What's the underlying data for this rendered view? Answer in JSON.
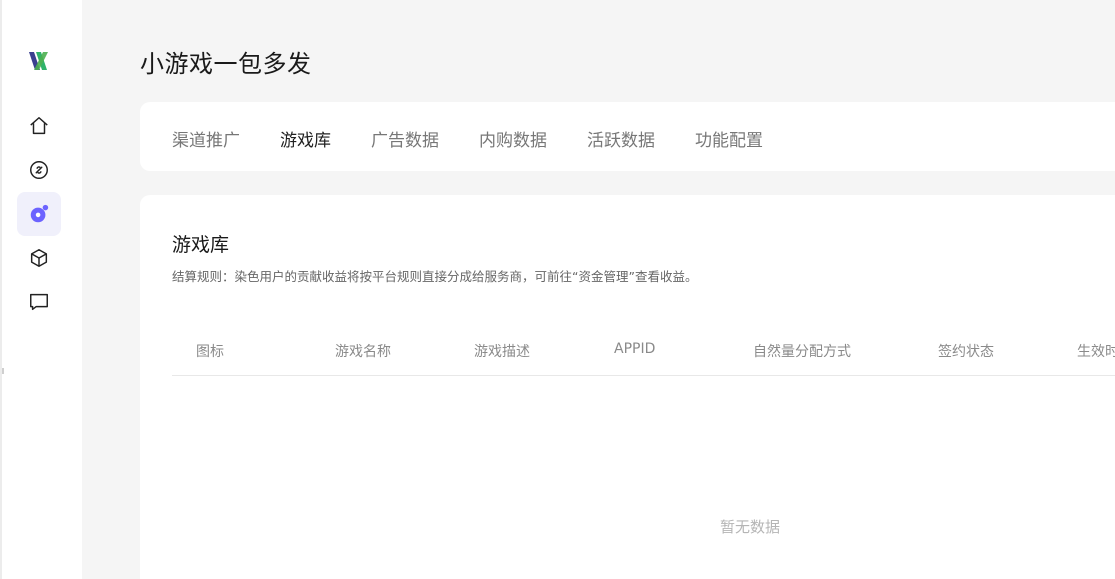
{
  "app": {
    "logo_icon": "brand-logo-icon",
    "accent": "#6c63ff"
  },
  "sidebar": {
    "items": [
      {
        "icon": "home-icon",
        "active": false
      },
      {
        "icon": "link-icon",
        "active": false
      },
      {
        "icon": "game-icon",
        "active": true
      },
      {
        "icon": "package-cube-icon",
        "active": false
      },
      {
        "icon": "message-icon",
        "active": false
      }
    ]
  },
  "header": {
    "title": "小游戏一包多发"
  },
  "tabs": [
    {
      "label": "渠道推广",
      "active": false
    },
    {
      "label": "游戏库",
      "active": true
    },
    {
      "label": "广告数据",
      "active": false
    },
    {
      "label": "内购数据",
      "active": false
    },
    {
      "label": "活跃数据",
      "active": false
    },
    {
      "label": "功能配置",
      "active": false
    }
  ],
  "section": {
    "title": "游戏库",
    "description": "结算规则：染色用户的贡献收益将按平台规则直接分成给服务商，可前往“资金管理”查看收益。"
  },
  "table": {
    "columns": [
      "图标",
      "游戏名称",
      "游戏描述",
      "APPID",
      "自然量分配方式",
      "签约状态",
      "生效时"
    ],
    "rows": [],
    "empty_text": "暂无数据"
  }
}
